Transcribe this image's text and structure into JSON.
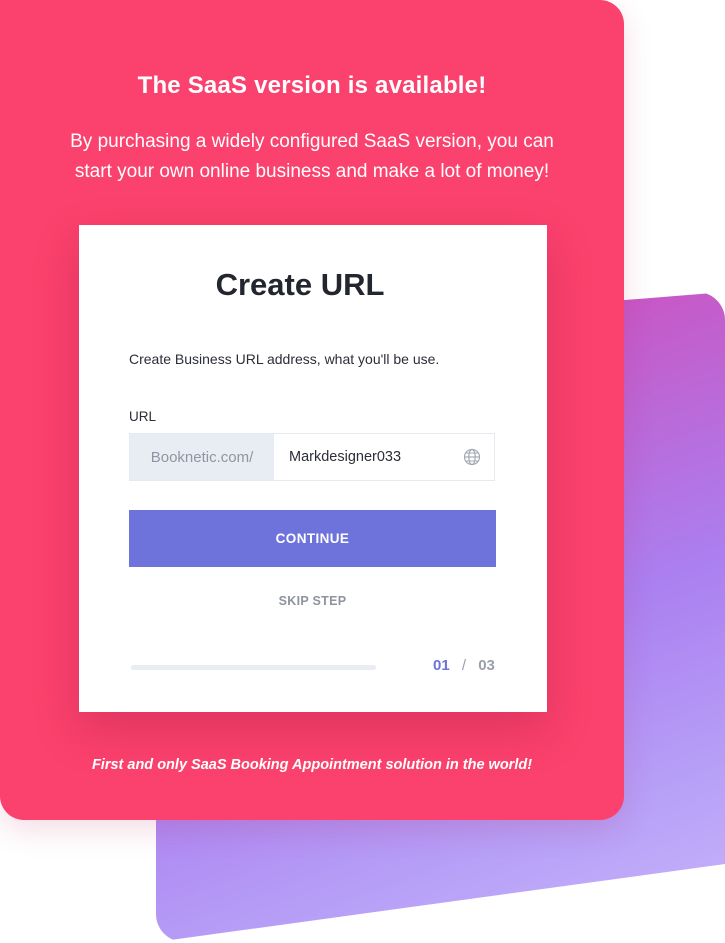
{
  "promo": {
    "headline": "The SaaS version is available!",
    "subtext_line1": "By purchasing a widely configured SaaS version, you can",
    "subtext_line2": "start your own online business and make a lot of money!",
    "footer_note": "First and only SaaS Booking Appointment solution in the world!"
  },
  "form": {
    "title": "Create URL",
    "description": "Create Business URL address, what you'll be use.",
    "url_label": "URL",
    "url_prefix": "Booknetic.com/",
    "url_value": "Markdesigner033",
    "continue_label": "CONTINUE",
    "skip_label": "SKIP STEP"
  },
  "progress": {
    "current_step": "01",
    "separator": "/",
    "total_steps": "03",
    "fraction": 0.33
  },
  "colors": {
    "card_red": "#fb416d",
    "accent": "#6d73da",
    "back_card_gradient_start": "#e0389a",
    "back_card_gradient_end": "#c9b6fb"
  },
  "icons": {
    "url_field_icon": "globe-icon"
  }
}
